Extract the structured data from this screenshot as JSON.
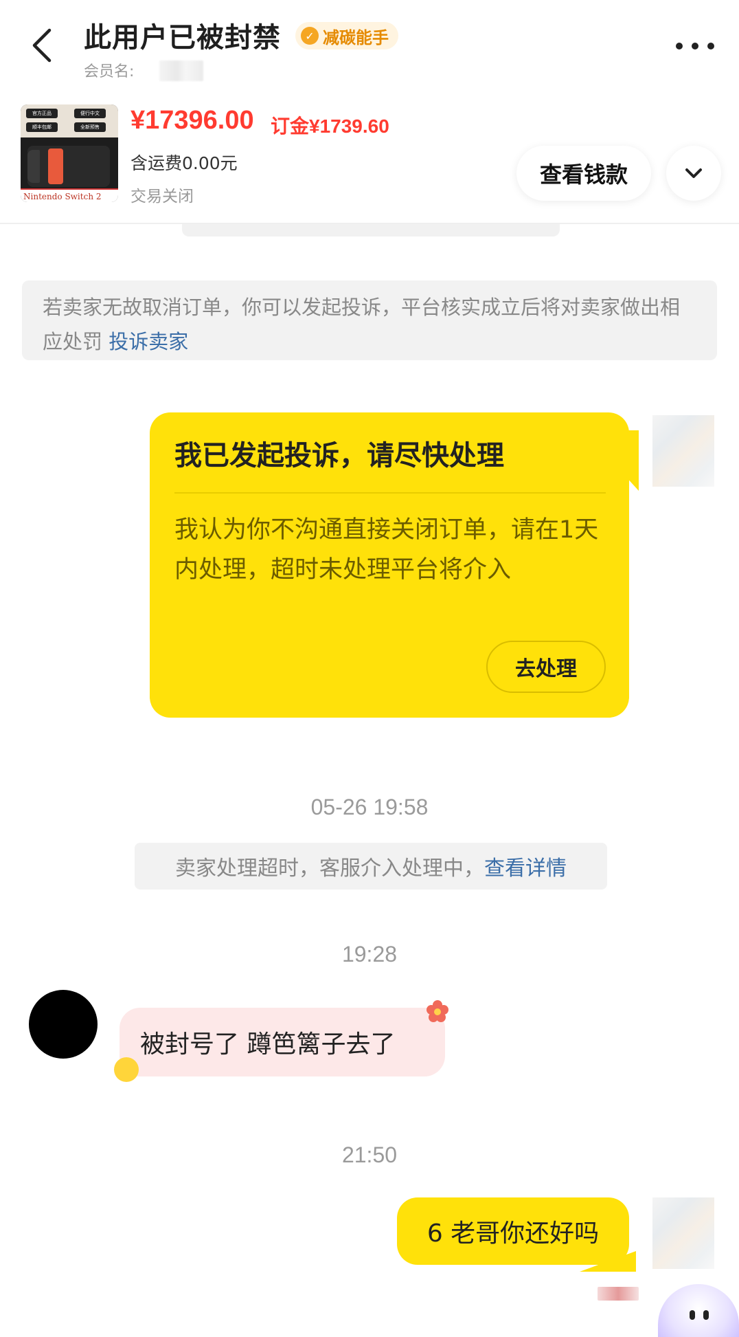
{
  "header": {
    "title": "此用户已被封禁",
    "badge_label": "减碳能手",
    "member_label": "会员名:"
  },
  "order": {
    "price": "¥17396.00",
    "deposit": "订金¥1739.60",
    "shipping": "含运费0.00元",
    "status": "交易关闭",
    "view_money_label": "查看钱款",
    "thumb_caption": "Nintendo Switch 2",
    "thumb_chips": [
      "官方正品",
      "便行中文",
      "顺丰包邮",
      "全新预售"
    ]
  },
  "notice": {
    "text": "若卖家无故取消订单，你可以发起投诉，平台核实成立后将对卖家做出相应处罚",
    "link": "投诉卖家"
  },
  "complaint_card": {
    "title": "我已发起投诉，请尽快处理",
    "body": "我认为你不沟通直接关闭订单，请在1天内处理，超时未处理平台将介入",
    "button": "去处理"
  },
  "messages": {
    "timestamp_1": "05-26 19:58",
    "system_text": "卖家处理超时，客服介入处理中，",
    "system_link": "查看详情",
    "timestamp_2": "19:28",
    "incoming_text": "被封号了 蹲笆篱子去了",
    "timestamp_3": "21:50",
    "outgoing_text": "6 老哥你还好吗"
  },
  "colors": {
    "accent_yellow": "#ffe10a",
    "price_red": "#ff3b30",
    "link_blue": "#3b6ea8",
    "badge_orange": "#e58a00"
  }
}
